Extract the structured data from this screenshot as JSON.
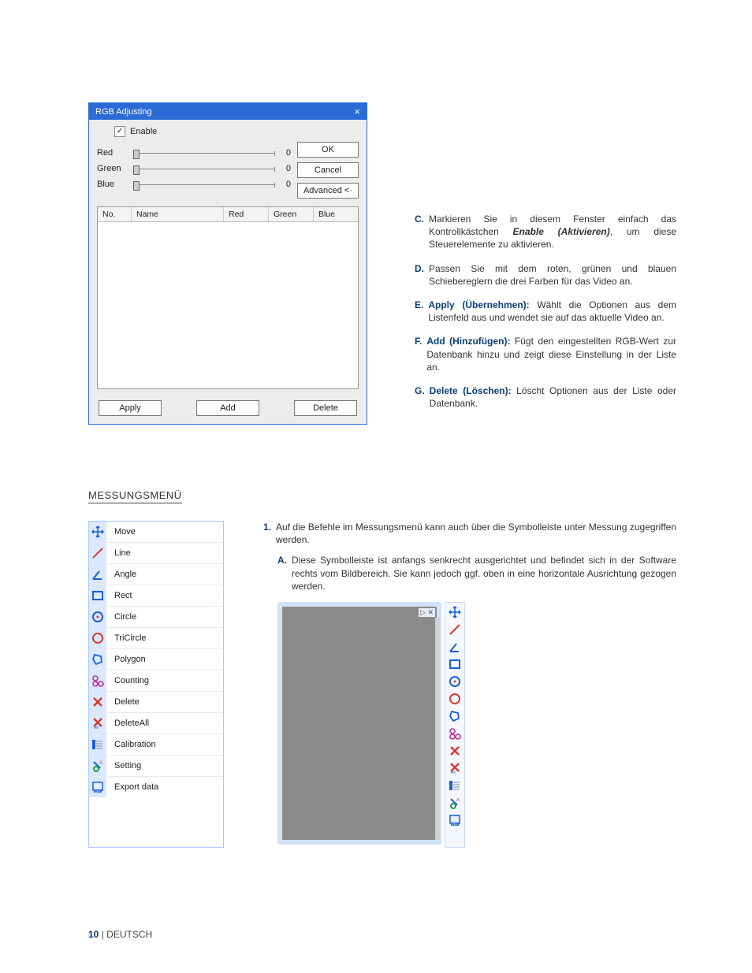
{
  "dialog": {
    "title": "RGB Adjusting",
    "enable_label": "Enable",
    "sliders": {
      "red": {
        "label": "Red",
        "value": "0"
      },
      "green": {
        "label": "Green",
        "value": "0"
      },
      "blue": {
        "label": "Blue",
        "value": "0"
      }
    },
    "buttons": {
      "ok": "OK",
      "cancel": "Cancel",
      "advanced": "Advanced <·"
    },
    "table_headers": {
      "no": "No.",
      "name": "Name",
      "red": "Red",
      "green": "Green",
      "blue": "Blue"
    },
    "footer_buttons": {
      "apply": "Apply",
      "add": "Add",
      "delete": "Delete"
    }
  },
  "notes_top": {
    "c": {
      "label": "C.",
      "pre": "Markieren Sie in diesem Fenster einfach das Kontrollkästchen ",
      "bold": "Enable (Aktivieren)",
      "post": ", um diese Steuerelemente zu aktivieren."
    },
    "d": {
      "label": "D.",
      "text": "Passen Sie mit dem roten, grünen und blauen Schiebereglern die drei Farben für das Video an."
    },
    "e": {
      "label": "E.",
      "head": "Apply (Übernehmen):",
      "text": " Wählt die Optionen aus dem Listenfeld aus und wendet sie auf das aktuelle Video an."
    },
    "f": {
      "label": "F.",
      "head": "Add (Hinzufügen):",
      "text": " Fügt den eingestellten RGB-Wert zur Datenbank hinzu und zeigt diese Einstellung in der Liste an."
    },
    "g": {
      "label": "G.",
      "head": "Delete (Löschen):",
      "text": " Löscht Optionen aus der Liste oder Datenbank."
    }
  },
  "section_heading": "MESSUNGSMENÜ",
  "menu_items": [
    {
      "icon": "move-icon",
      "label": "Move"
    },
    {
      "icon": "line-icon",
      "label": "Line"
    },
    {
      "icon": "angle-icon",
      "label": "Angle"
    },
    {
      "icon": "rect-icon",
      "label": "Rect"
    },
    {
      "icon": "circle-icon",
      "label": "Circle"
    },
    {
      "icon": "tricircle-icon",
      "label": "TriCircle"
    },
    {
      "icon": "polygon-icon",
      "label": "Polygon"
    },
    {
      "icon": "counting-icon",
      "label": "Counting"
    },
    {
      "icon": "delete-icon",
      "label": "Delete"
    },
    {
      "icon": "deleteall-icon",
      "label": "DeleteAll"
    },
    {
      "icon": "calibration-icon",
      "label": "Calibration"
    },
    {
      "icon": "setting-icon",
      "label": "Setting"
    },
    {
      "icon": "export-icon",
      "label": "Export data"
    }
  ],
  "lower_text": {
    "n1": {
      "label": "1.",
      "text": "Auf die Befehle im Messungsmenü kann auch über die Symbolleiste unter Messung zugegriffen werden."
    },
    "a": {
      "label": "A.",
      "text": "Diese Symbolleiste ist anfangs senkrecht ausgerichtet und befindet sich in der Software rechts vom Bildbereich. Sie kann jedoch ggf. oben in eine horizontale Ausrichtung gezogen werden."
    }
  },
  "panel_bar": "▷  ✕",
  "footer": {
    "page": "10",
    "sep": " | ",
    "lang": "DEUTSCH"
  }
}
